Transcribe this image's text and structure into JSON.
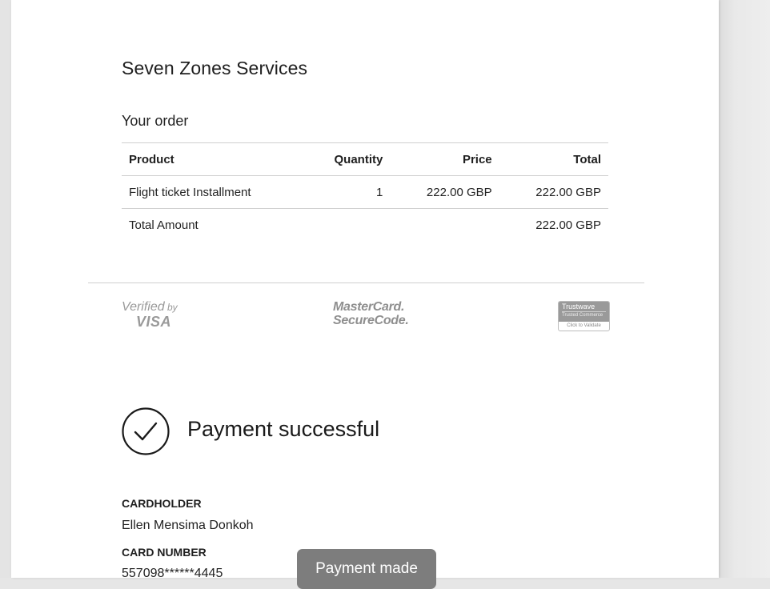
{
  "merchant": {
    "name": "Seven Zones Services"
  },
  "order": {
    "title": "Your order",
    "columns": {
      "product": "Product",
      "quantity": "Quantity",
      "price": "Price",
      "total": "Total"
    },
    "items": [
      {
        "product": "Flight ticket Installment",
        "quantity": "1",
        "price": "222.00 GBP",
        "total": "222.00 GBP"
      }
    ],
    "total_label": "Total Amount",
    "total_value": "222.00 GBP"
  },
  "security_logos": {
    "visa_verified": "Verified",
    "visa_by": "by",
    "visa": "VISA",
    "mastercard_line1": "MasterCard.",
    "mastercard_line2": "SecureCode.",
    "trustwave": "Trustwave",
    "trustwave_sub": "Trusted Commerce",
    "trustwave_validate": "Click to Validate"
  },
  "payment": {
    "status_icon": "check-circle-icon",
    "status": "Payment successful",
    "cardholder_label": "CARDHOLDER",
    "cardholder_value": "Ellen Mensima Donkoh",
    "card_number_label": "CARD NUMBER",
    "card_number_value": "557098******4445"
  },
  "toast": {
    "message": "Payment made"
  },
  "colors": {
    "backdrop": "#e6e6e6",
    "page": "#ffffff",
    "toast_bg": "#7d7d7d",
    "logo_gray": "#9a9a9a"
  }
}
